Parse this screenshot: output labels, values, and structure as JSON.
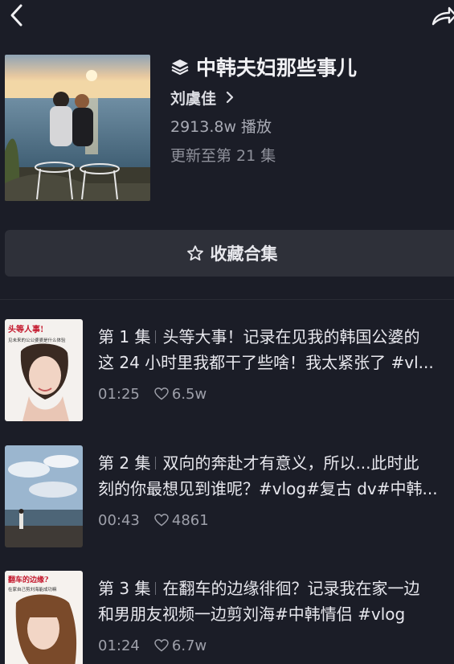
{
  "header": {
    "title": "中韩夫妇那些事儿",
    "author": "刘虞佳",
    "plays": "2913.8w 播放",
    "updated": "更新至第 21 集"
  },
  "collect_button": {
    "label": "收藏合集"
  },
  "episodes": [
    {
      "number": "第 1 集",
      "line1": "头等大事！记录在见我的韩国公婆的",
      "line2": "这 24 小时里我都干了些啥！我太紧张了 #vl...",
      "duration": "01:25",
      "likes": "6.5w",
      "thumb_text_1": "头等人事!",
      "thumb_text_2": "见未来的公公婆婆是什么体验"
    },
    {
      "number": "第 2 集",
      "line1": "双向的奔赴才有意义，所以...此时此",
      "line2": "刻的你最想见到谁呢？#vlog#复古 dv#中韩...",
      "duration": "00:43",
      "likes": "4861"
    },
    {
      "number": "第 3 集",
      "line1": "在翻车的边缘徘徊？记录我在家一边",
      "line2": "和男朋友视频一边剪刘海#中韩情侣 #vlog",
      "duration": "01:24",
      "likes": "6.7w",
      "thumb_text_1": "翻车的边缘?",
      "thumb_text_2": "在家自己剪刘海能成功嘛"
    }
  ],
  "colors": {
    "background": "#1b1d27",
    "button_bg": "#2e3039",
    "muted_text": "#9ea0aa"
  },
  "icons": [
    "back-arrow-icon",
    "share-icon",
    "stack-layers-icon",
    "chevron-right-icon",
    "star-outline-icon",
    "heart-outline-icon"
  ]
}
